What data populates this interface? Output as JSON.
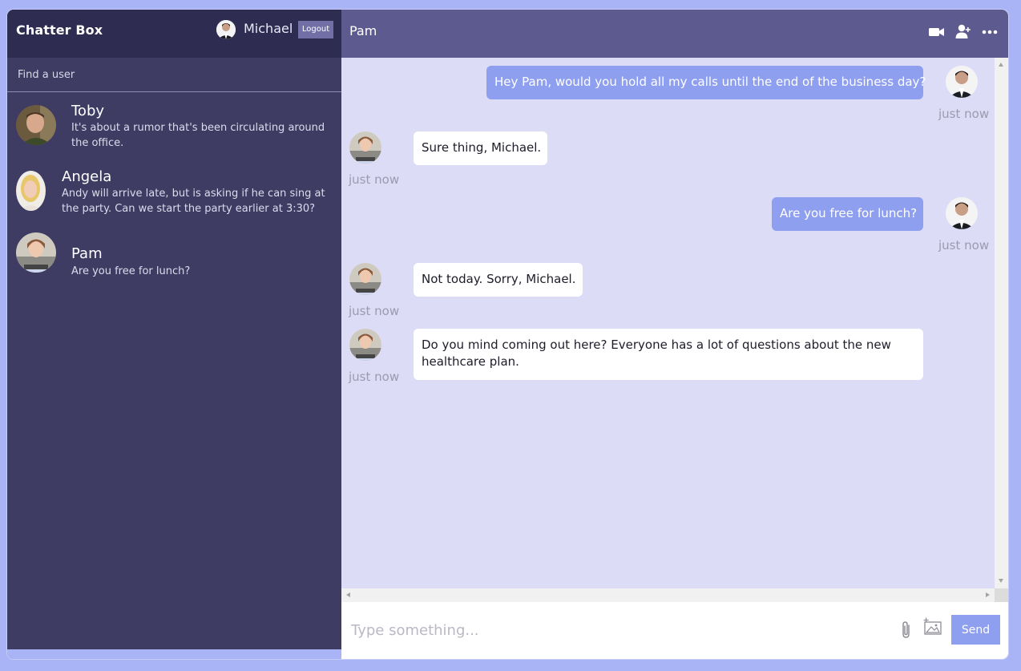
{
  "app": {
    "title": "Chatter Box"
  },
  "user": {
    "name": "Michael",
    "logout_label": "Logout"
  },
  "search": {
    "placeholder": "Find a user"
  },
  "conversations": [
    {
      "name": "Toby",
      "preview": "It's about a rumor that's been circulating around the office."
    },
    {
      "name": "Angela",
      "preview": "Andy will arrive late, but is asking if he can sing at the party. Can we start the party earlier at 3:30?"
    },
    {
      "name": "Pam",
      "preview": "Are you free for lunch?"
    }
  ],
  "chat": {
    "title": "Pam",
    "header_icons": [
      "video-call-icon",
      "add-user-icon",
      "more-options-icon"
    ],
    "messages": [
      {
        "direction": "out",
        "text": "Hey Pam, would you hold all my calls until the end of the business day?",
        "time": "just now"
      },
      {
        "direction": "in",
        "text": "Sure thing, Michael.",
        "time": "just now"
      },
      {
        "direction": "out",
        "text": "Are you free for lunch?",
        "time": "just now"
      },
      {
        "direction": "in",
        "text": "Not today. Sorry, Michael.",
        "time": "just now"
      },
      {
        "direction": "in",
        "text": "Do you mind coming out here? Everyone has a lot of questions about the new healthcare plan.",
        "time": "just now"
      }
    ]
  },
  "composer": {
    "placeholder": "Type something...",
    "send_label": "Send"
  },
  "colors": {
    "background": "#a9b4f6",
    "sidebar": "#3e3c62",
    "sidebar_header": "#2e2c50",
    "chat_header": "#5d5a8f",
    "chat_background": "#dcdcf6",
    "outgoing_bubble": "#8e9ff0",
    "incoming_bubble": "#ffffff"
  }
}
